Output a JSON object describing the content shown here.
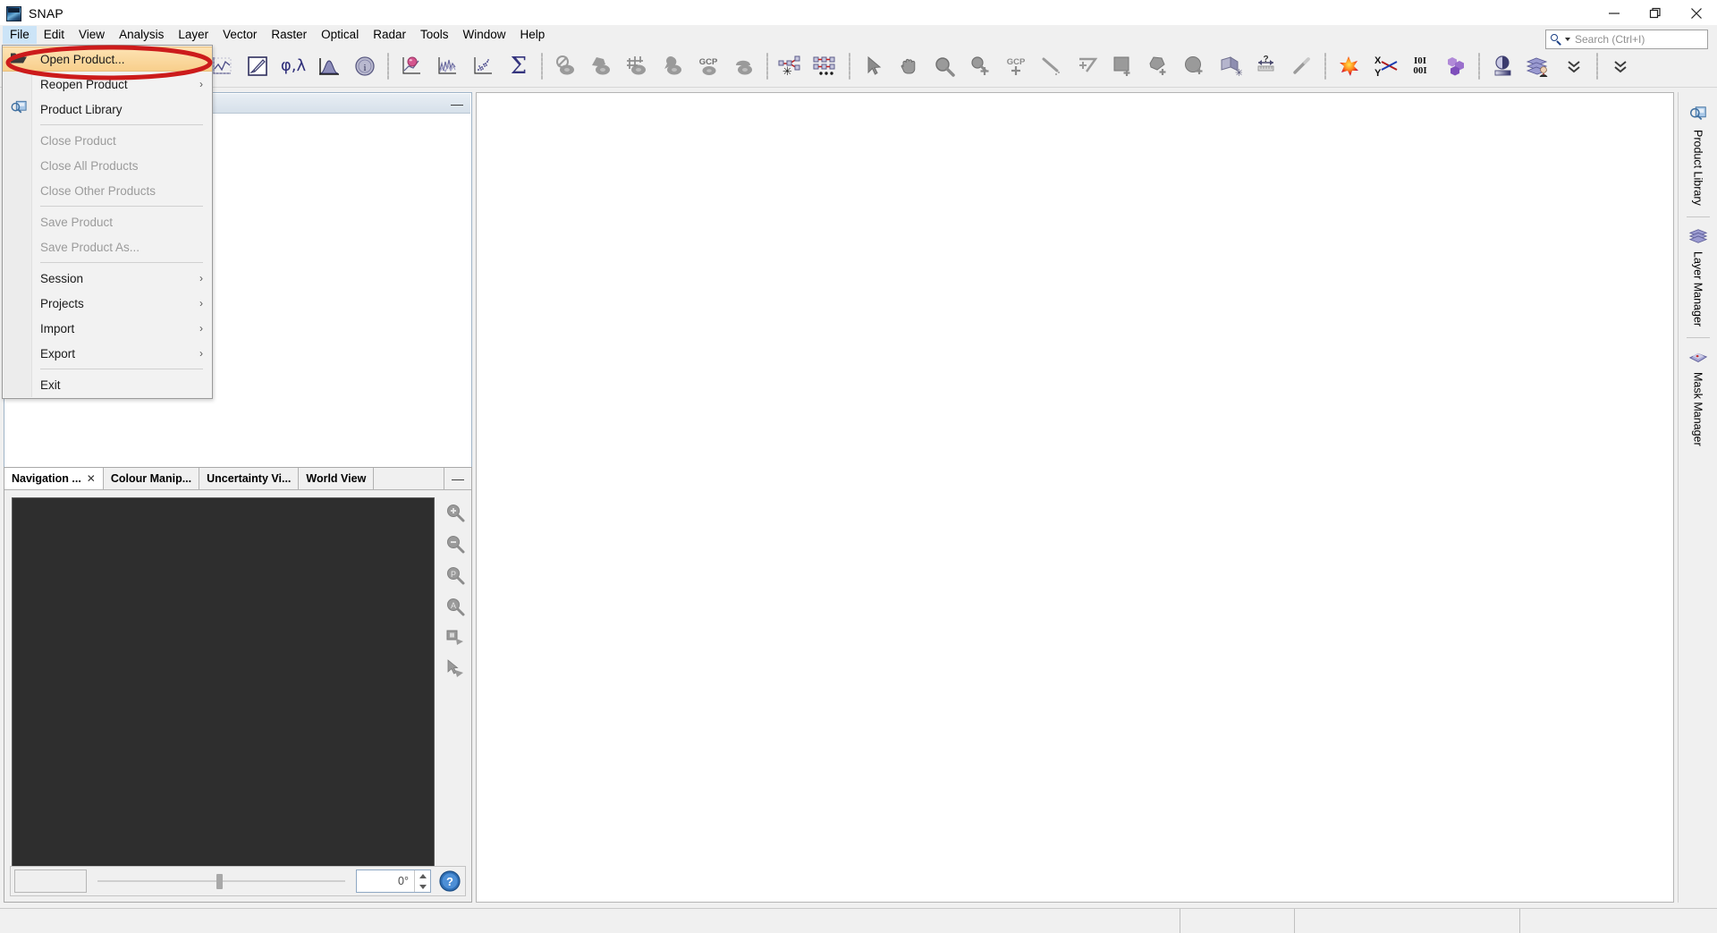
{
  "window": {
    "title": "SNAP",
    "app_icon": "snap-logo-icon",
    "controls": {
      "minimize": "minimize-icon",
      "maximize": "maximize-icon",
      "close": "close-icon"
    }
  },
  "search": {
    "placeholder": "Search (Ctrl+I)",
    "value": "",
    "icon": "search-icon"
  },
  "menubar": {
    "items": [
      {
        "label": "File",
        "open": true
      },
      {
        "label": "Edit",
        "open": false
      },
      {
        "label": "View",
        "open": false
      },
      {
        "label": "Analysis",
        "open": false
      },
      {
        "label": "Layer",
        "open": false
      },
      {
        "label": "Vector",
        "open": false
      },
      {
        "label": "Raster",
        "open": false
      },
      {
        "label": "Optical",
        "open": false
      },
      {
        "label": "Radar",
        "open": false
      },
      {
        "label": "Tools",
        "open": false
      },
      {
        "label": "Window",
        "open": false
      },
      {
        "label": "Help",
        "open": false
      }
    ]
  },
  "file_menu": {
    "items": [
      {
        "label": "Open Product...",
        "icon": "open-folder-icon",
        "enabled": true,
        "submenu": false,
        "highlighted": true
      },
      {
        "label": "Reopen Product",
        "icon": "",
        "enabled": true,
        "submenu": true,
        "highlighted": false
      },
      {
        "label": "Product Library",
        "icon": "product-library-icon",
        "enabled": true,
        "submenu": false,
        "highlighted": false
      },
      {
        "separator": true
      },
      {
        "label": "Close Product",
        "icon": "",
        "enabled": false,
        "submenu": false,
        "highlighted": false
      },
      {
        "label": "Close All Products",
        "icon": "",
        "enabled": false,
        "submenu": false,
        "highlighted": false
      },
      {
        "label": "Close Other Products",
        "icon": "",
        "enabled": false,
        "submenu": false,
        "highlighted": false
      },
      {
        "separator": true
      },
      {
        "label": "Save Product",
        "icon": "",
        "enabled": false,
        "submenu": false,
        "highlighted": false
      },
      {
        "label": "Save Product As...",
        "icon": "",
        "enabled": false,
        "submenu": false,
        "highlighted": false
      },
      {
        "separator": true
      },
      {
        "label": "Session",
        "icon": "",
        "enabled": true,
        "submenu": true,
        "highlighted": false
      },
      {
        "label": "Projects",
        "icon": "",
        "enabled": true,
        "submenu": true,
        "highlighted": false
      },
      {
        "label": "Import",
        "icon": "",
        "enabled": true,
        "submenu": true,
        "highlighted": false
      },
      {
        "label": "Export",
        "icon": "",
        "enabled": true,
        "submenu": true,
        "highlighted": false
      },
      {
        "separator": true
      },
      {
        "label": "Exit",
        "icon": "",
        "enabled": true,
        "submenu": false,
        "highlighted": false
      }
    ],
    "submenu_arrow": "›"
  },
  "annotation": {
    "shape": "ellipse",
    "color": "#cc1b1b",
    "target": "Open Product..."
  },
  "toolbar": {
    "groups": [
      {
        "buttons": [
          {
            "name": "open-product-button",
            "icon": "open-folder-green-arrow-icon"
          },
          {
            "name": "save-product-button",
            "icon": "save-folder-icon"
          }
        ]
      },
      {
        "buttons": [
          {
            "name": "open-rgb-image-window-button",
            "icon": "rgb-palette-icon"
          },
          {
            "name": "open-image-window-button",
            "icon": "stacked-images-icon"
          },
          {
            "name": "open-spectrum-view-button",
            "icon": "wave-icon"
          }
        ]
      },
      {
        "buttons": [
          {
            "name": "profile-plot-button",
            "icon": "profile-plot-icon"
          },
          {
            "name": "colour-manipulation-button",
            "icon": "pen-square-icon"
          },
          {
            "name": "geo-coding-button",
            "icon": "phi-lambda-icon",
            "text": "φ,λ"
          },
          {
            "name": "histogram-button",
            "icon": "histogram-icon"
          },
          {
            "name": "information-button",
            "icon": "information-icon"
          }
        ]
      },
      {
        "buttons": [
          {
            "name": "scatter-plot-button",
            "icon": "scatter-bubble-icon"
          },
          {
            "name": "spectrum-view-button",
            "icon": "spectrum-plot-icon"
          },
          {
            "name": "correlative-plot-button",
            "icon": "correlative-plot-icon"
          },
          {
            "name": "statistics-button",
            "icon": "sigma-icon",
            "text": "Σ"
          }
        ]
      },
      {
        "buttons": [
          {
            "name": "no-data-overlay-button",
            "icon": "no-data-icon"
          },
          {
            "name": "geometry-overlay-button",
            "icon": "geometry-overlay-icon"
          },
          {
            "name": "graticule-overlay-button",
            "icon": "graticule-icon"
          },
          {
            "name": "pin-overlay-button",
            "icon": "pin-overlay-icon"
          },
          {
            "name": "gcp-overlay-button",
            "icon": "gcp-overlay-icon",
            "text": "GCP"
          },
          {
            "name": "mask-overlay-button",
            "icon": "mask-overlay-icon"
          }
        ]
      },
      {
        "buttons": [
          {
            "name": "graph-builder-button",
            "icon": "graph-builder-icon"
          },
          {
            "name": "batch-processing-button",
            "icon": "batch-processing-icon"
          }
        ]
      },
      {
        "buttons": [
          {
            "name": "selection-tool-button",
            "icon": "arrow-cursor-icon"
          },
          {
            "name": "pan-tool-button",
            "icon": "hand-icon"
          },
          {
            "name": "zoom-tool-button",
            "icon": "magnifier-icon"
          },
          {
            "name": "pin-tool-button",
            "icon": "pin-plus-icon"
          },
          {
            "name": "gcp-tool-button",
            "icon": "gcp-plus-icon",
            "text": "GCP"
          },
          {
            "name": "line-drawing-tool-button",
            "icon": "line-tool-icon"
          },
          {
            "name": "polyline-drawing-tool-button",
            "icon": "polyline-tool-icon"
          },
          {
            "name": "rectangle-drawing-tool-button",
            "icon": "rectangle-tool-icon"
          },
          {
            "name": "polygon-drawing-tool-button",
            "icon": "polygon-tool-icon"
          },
          {
            "name": "ellipse-drawing-tool-button",
            "icon": "ellipse-tool-icon"
          },
          {
            "name": "magic-stick-tool-button",
            "icon": "magic-wand-selection-icon"
          },
          {
            "name": "range-finder-tool-button",
            "icon": "range-finder-icon"
          },
          {
            "name": "magic-wand-button",
            "icon": "magic-wand-icon"
          }
        ]
      },
      {
        "buttons": [
          {
            "name": "colour-star-button",
            "icon": "colour-star-icon"
          },
          {
            "name": "xy-scatter-button",
            "icon": "xy-axis-icon",
            "text": "X Y"
          },
          {
            "name": "binary-data-button",
            "icon": "binary-data-icon",
            "text": "I0I 00I"
          },
          {
            "name": "cluster-analysis-button",
            "icon": "hexagon-cluster-icon"
          }
        ]
      },
      {
        "buttons": [
          {
            "name": "contrast-button",
            "icon": "contrast-gradient-icon"
          },
          {
            "name": "layer-manager-button",
            "icon": "layer-person-icon"
          },
          {
            "name": "toolbar-overflow-button",
            "icon": "chevron-double-down-icon",
            "text": "ˇˇ"
          }
        ]
      },
      {
        "buttons": [
          {
            "name": "toolbar-expand-button",
            "icon": "chevron-double-down-icon",
            "text": "ˇˇ"
          }
        ]
      }
    ]
  },
  "left_top_panel": {
    "name": "product-explorer-panel",
    "minimize_glyph": "—"
  },
  "nav_panel": {
    "tabs": [
      {
        "label": "Navigation ...",
        "active": true,
        "closable": true
      },
      {
        "label": "Colour Manip...",
        "active": false,
        "closable": false
      },
      {
        "label": "Uncertainty Vi...",
        "active": false,
        "closable": false
      },
      {
        "label": "World View",
        "active": false,
        "closable": false
      }
    ],
    "close_glyph": "✕",
    "minimize_glyph": "—",
    "side_buttons": [
      {
        "name": "zoom-in-button",
        "icon": "zoom-in-icon"
      },
      {
        "name": "zoom-out-button",
        "icon": "zoom-out-icon"
      },
      {
        "name": "zoom-to-pixel-button",
        "icon": "zoom-pixel-icon"
      },
      {
        "name": "zoom-all-button",
        "icon": "zoom-all-icon"
      },
      {
        "name": "sync-views-button",
        "icon": "sync-views-icon"
      },
      {
        "name": "sync-cursors-button",
        "icon": "sync-cursor-icon"
      }
    ],
    "zoom_field_value": "",
    "rotation_value": "0°",
    "help_icon": "help-question-icon"
  },
  "right_tabs": [
    {
      "label": "Product Library",
      "icon": "product-library-icon"
    },
    {
      "label": "Layer Manager",
      "icon": "layer-manager-icon"
    },
    {
      "label": "Mask Manager",
      "icon": "mask-manager-icon"
    }
  ],
  "statusbar": {
    "segments": [
      "",
      "",
      "",
      ""
    ]
  },
  "colors": {
    "window_bg": "#f0f0f0",
    "panel_bg": "#ffffff",
    "menu_highlight_top": "#fde3b4",
    "menu_highlight_bottom": "#f8cf8c",
    "annotation_red": "#cc1b1b",
    "menu_open_blue": "#cce4f7",
    "nav_canvas": "#2e2e2e"
  }
}
